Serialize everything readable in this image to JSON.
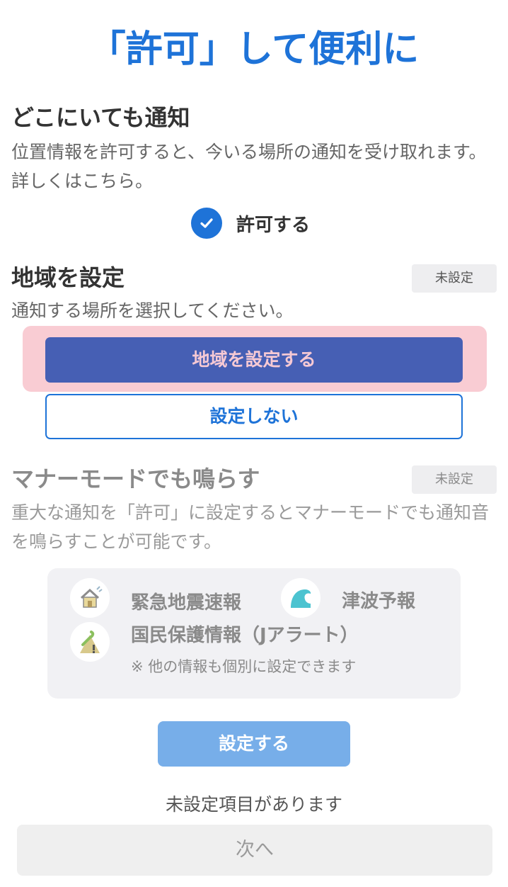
{
  "title": "「許可」して便利に",
  "notify_anywhere": {
    "heading": "どこにいても通知",
    "description": "位置情報を許可すると、今いる場所の通知を受け取れます。詳しくはこちら。",
    "permit_label": "許可する",
    "permit_checked": true
  },
  "region": {
    "heading": "地域を設定",
    "status": "未設定",
    "description": "通知する場所を選択してください。",
    "set_button": "地域を設定する",
    "skip_button": "設定しない"
  },
  "manner_mode": {
    "heading": "マナーモードでも鳴らす",
    "status": "未設定",
    "description": "重大な通知を「許可」に設定するとマナーモードでも通知音を鳴らすことが可能です。",
    "alerts": [
      {
        "label": "緊急地震速報",
        "icon": "earthquake-house-icon"
      },
      {
        "label": "津波予報",
        "icon": "tsunami-wave-icon"
      },
      {
        "label": "国民保護情報（Jアラート）",
        "icon": "japan-alert-icon"
      }
    ],
    "note": "※ 他の情報も個別に設定できます",
    "set_button": "設定する"
  },
  "footer": {
    "notice": "未設定項目があります",
    "next_button": "次へ"
  },
  "colors": {
    "accent": "#1e73d8",
    "primary_button": "#465fb4",
    "highlight": "#f9ccd3"
  }
}
